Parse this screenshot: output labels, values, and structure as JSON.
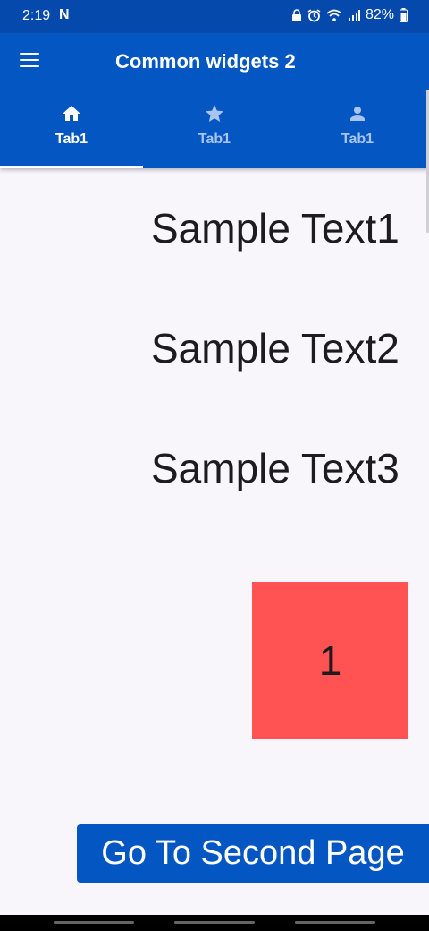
{
  "status_bar": {
    "time": "2:19",
    "notification": "N",
    "battery": "82%",
    "icons": [
      "lock-icon",
      "alarm-icon",
      "wifi-icon",
      "signal-icon",
      "battery-icon"
    ]
  },
  "app_bar": {
    "title": "Common widgets 2",
    "menu_icon": "menu-icon"
  },
  "tabs": [
    {
      "label": "Tab1",
      "icon": "home-icon",
      "active": true
    },
    {
      "label": "Tab1",
      "icon": "star-icon",
      "active": false
    },
    {
      "label": "Tab1",
      "icon": "person-icon",
      "active": false
    }
  ],
  "content": {
    "texts": [
      "Sample Text1",
      "Sample Text2",
      "Sample Text3"
    ],
    "box_label": "1",
    "button_label": "Go To Second Page"
  },
  "colors": {
    "primary": "#0457c2",
    "status_bar": "#0449ab",
    "box": "#ff5252",
    "background": "#f8f5fb"
  }
}
